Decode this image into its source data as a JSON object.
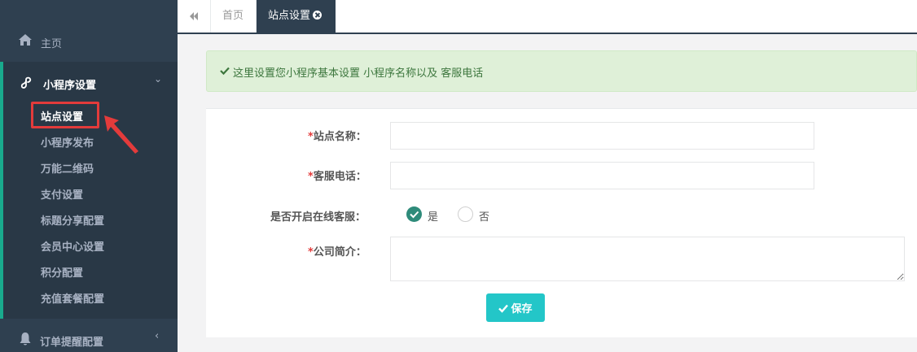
{
  "sidebar": {
    "home": {
      "label": "主页",
      "icon": "home-icon"
    },
    "group": {
      "label": "小程序设置",
      "icon": "miniprogram-icon",
      "items": [
        {
          "label": "站点设置",
          "active": true
        },
        {
          "label": "小程序发布"
        },
        {
          "label": "万能二维码"
        },
        {
          "label": "支付设置"
        },
        {
          "label": "标题分享配置"
        },
        {
          "label": "会员中心设置"
        },
        {
          "label": "积分配置"
        },
        {
          "label": "充值套餐配置"
        }
      ]
    },
    "bottom": {
      "label": "订单提醒配置",
      "icon": "bell-icon"
    }
  },
  "tabs": {
    "home": "首页",
    "active": "站点设置"
  },
  "alert": {
    "text": "这里设置您小程序基本设置 小程序名称以及 客服电话"
  },
  "form": {
    "site_name": {
      "required_mark": "*",
      "label": "站点名称：",
      "value": ""
    },
    "service_phone": {
      "required_mark": "*",
      "label": "客服电话：",
      "value": ""
    },
    "online_service": {
      "label": "是否开启在线客服：",
      "options": [
        "是",
        "否"
      ],
      "selected": "是"
    },
    "company_intro": {
      "required_mark": "*",
      "label": "公司简介：",
      "value": ""
    },
    "save_label": "保存"
  },
  "colors": {
    "sidebar_bg": "#2f4050",
    "sidebar_active_bg": "#293846",
    "accent": "#19aa8d",
    "alert_bg": "#dff0d8",
    "save_button": "#23c6c8",
    "annotation_red": "#e33b3b"
  }
}
